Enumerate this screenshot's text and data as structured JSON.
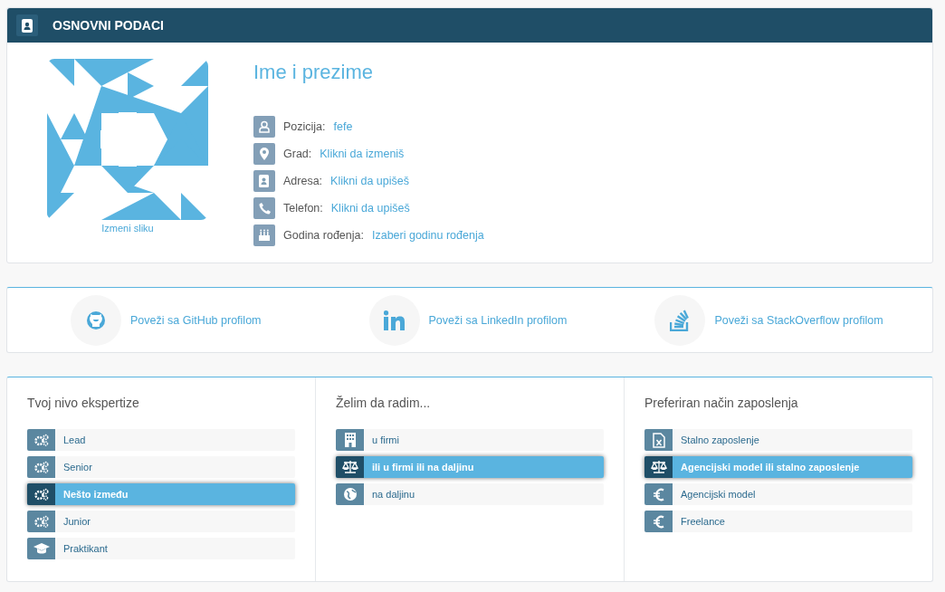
{
  "profile_panel": {
    "title": "OSNOVNI PODACI",
    "name": "Ime i prezime",
    "change_photo": "Izmeni sliku",
    "fields": [
      {
        "label": "Pozicija:",
        "value": "fefe"
      },
      {
        "label": "Grad:",
        "value": "Klikni da izmeniš"
      },
      {
        "label": "Adresa:",
        "value": "Klikni da upišeš"
      },
      {
        "label": "Telefon:",
        "value": "Klikni da upišeš"
      },
      {
        "label": "Godina rođenja:",
        "value": "Izaberi godinu rođenja"
      }
    ]
  },
  "social_links": [
    "Poveži sa GitHub profilom",
    "Poveži sa LinkedIn profilom",
    "Poveži sa StackOverflow profilom"
  ],
  "preferences": [
    {
      "title": "Tvoj nivo ekspertize",
      "options": [
        {
          "label": "Lead",
          "selected": false
        },
        {
          "label": "Senior",
          "selected": false
        },
        {
          "label": "Nešto između",
          "selected": true
        },
        {
          "label": "Junior",
          "selected": false
        },
        {
          "label": "Praktikant",
          "selected": false
        }
      ]
    },
    {
      "title": "Želim da radim...",
      "options": [
        {
          "label": "u firmi",
          "selected": false
        },
        {
          "label": "ili u firmi ili na daljinu",
          "selected": true
        },
        {
          "label": "na daljinu",
          "selected": false
        }
      ]
    },
    {
      "title": "Preferiran način zaposlenja",
      "options": [
        {
          "label": "Stalno zaposlenje",
          "selected": false
        },
        {
          "label": "Agencijski model ili stalno zaposlenje",
          "selected": true
        },
        {
          "label": "Agencijski model",
          "selected": false
        },
        {
          "label": "Freelance",
          "selected": false
        }
      ]
    }
  ]
}
